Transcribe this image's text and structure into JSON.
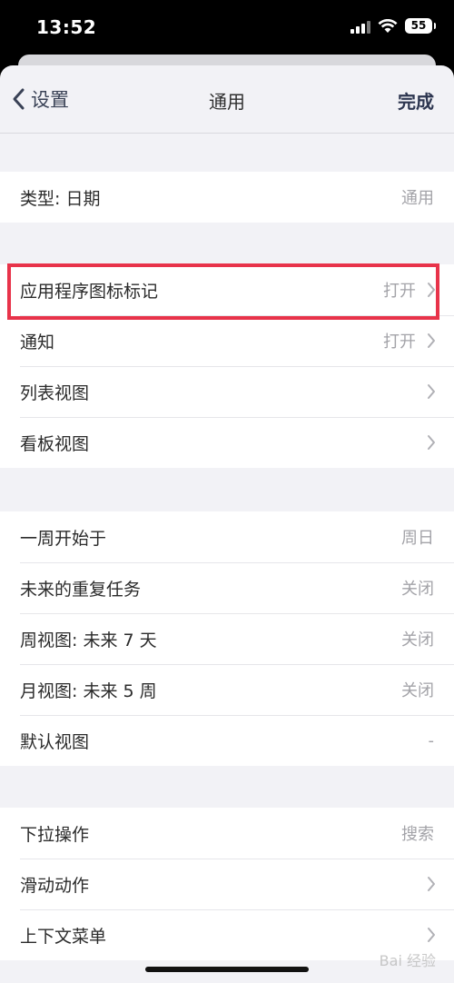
{
  "status_bar": {
    "time": "13:52",
    "battery": "55"
  },
  "nav": {
    "back_label": "设置",
    "title": "通用",
    "done_label": "完成"
  },
  "groups": [
    {
      "rows": [
        {
          "label": "类型: 日期",
          "value": "通用",
          "chevron": false
        }
      ]
    },
    {
      "rows": [
        {
          "label": "应用程序图标标记",
          "value": "打开",
          "chevron": true
        },
        {
          "label": "通知",
          "value": "打开",
          "chevron": true
        },
        {
          "label": "列表视图",
          "value": "",
          "chevron": true
        },
        {
          "label": "看板视图",
          "value": "",
          "chevron": true
        }
      ]
    },
    {
      "rows": [
        {
          "label": "一周开始于",
          "value": "周日",
          "chevron": false
        },
        {
          "label": "未来的重复任务",
          "value": "关闭",
          "chevron": false
        },
        {
          "label": "周视图: 未来 7 天",
          "value": "关闭",
          "chevron": false
        },
        {
          "label": "月视图: 未来 5 周",
          "value": "关闭",
          "chevron": false
        },
        {
          "label": "默认视图",
          "value": "-",
          "chevron": false
        }
      ]
    },
    {
      "rows": [
        {
          "label": "下拉操作",
          "value": "搜索",
          "chevron": false
        },
        {
          "label": "滑动动作",
          "value": "",
          "chevron": true
        },
        {
          "label": "上下文菜单",
          "value": "",
          "chevron": true
        }
      ]
    }
  ],
  "watermark": "Bai 经验",
  "colors": {
    "highlight": "#e8334a",
    "accent": "#2d3650"
  }
}
